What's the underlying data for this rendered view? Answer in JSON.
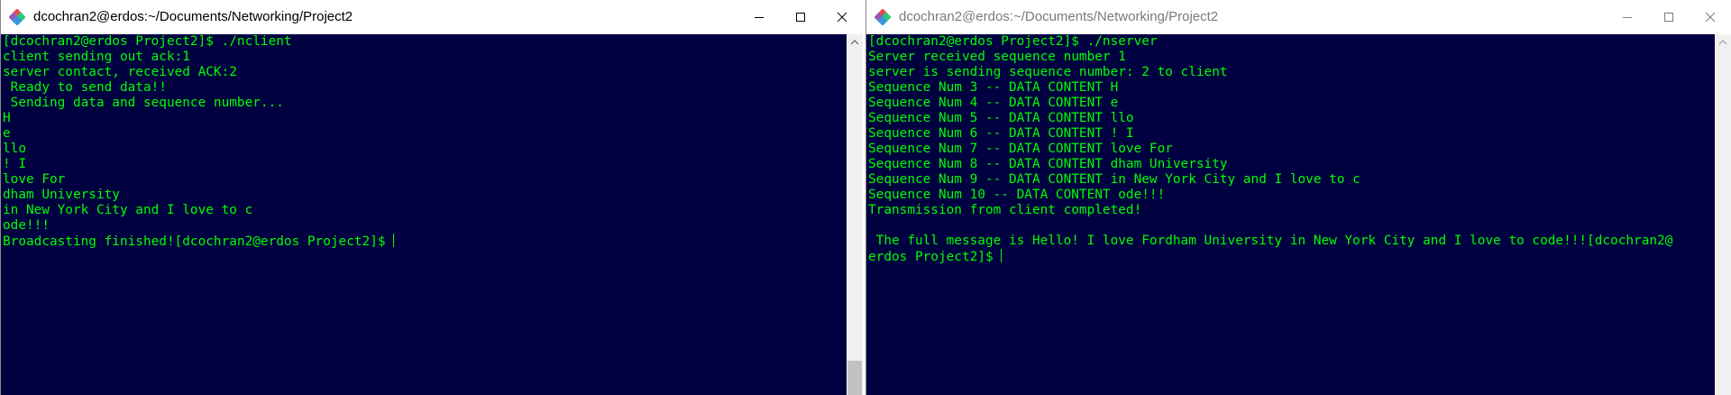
{
  "left_window": {
    "title": "dcochran2@erdos:~/Documents/Networking/Project2",
    "icon": "mintty-icon",
    "terminal_lines": [
      "[dcochran2@erdos Project2]$ ./nclient",
      "client sending out ack:1",
      "server contact, received ACK:2",
      " Ready to send data!!",
      " Sending data and sequence number...",
      "H",
      "e",
      "llo",
      "! I",
      "love For",
      "dham University",
      "in New York City and I love to c",
      "ode!!!"
    ],
    "prompt_line": "Broadcasting finished![dcochran2@erdos Project2]$ "
  },
  "right_window": {
    "title": "dcochran2@erdos:~/Documents/Networking/Project2",
    "icon": "mintty-icon",
    "terminal_lines": [
      "[dcochran2@erdos Project2]$ ./nserver",
      "Server received sequence number 1",
      "server is sending sequence number: 2 to client",
      "Sequence Num 3 -- DATA CONTENT H",
      "Sequence Num 4 -- DATA CONTENT e",
      "Sequence Num 5 -- DATA CONTENT llo",
      "Sequence Num 6 -- DATA CONTENT ! I",
      "Sequence Num 7 -- DATA CONTENT love For",
      "Sequence Num 8 -- DATA CONTENT dham University",
      "Sequence Num 9 -- DATA CONTENT in New York City and I love to c",
      "Sequence Num 10 -- DATA CONTENT ode!!!",
      "Transmission from client completed!",
      "",
      " The full message is Hello! I love Fordham University in New York City and I love to code!!![dcochran2@"
    ],
    "prompt_line": "erdos Project2]$ "
  },
  "colors": {
    "terminal_background": "#000040",
    "terminal_foreground": "#00ff00",
    "titlebar_active_text": "#000000",
    "titlebar_inactive_text": "#7a7a7a"
  },
  "window_controls": [
    "minimize-icon",
    "maximize-icon",
    "close-icon"
  ]
}
